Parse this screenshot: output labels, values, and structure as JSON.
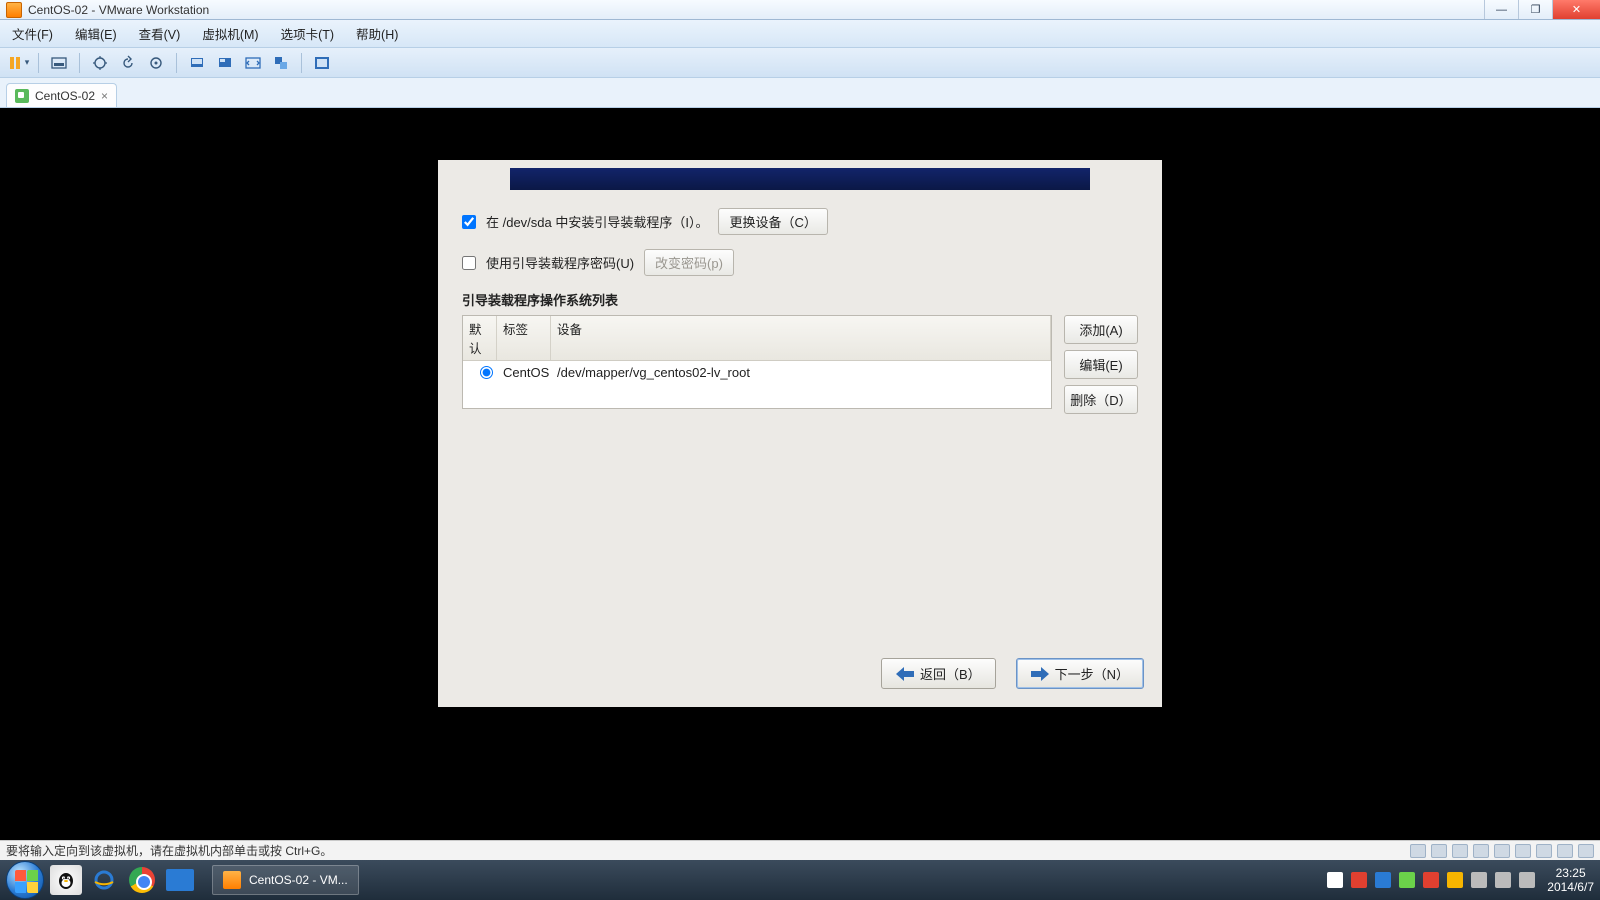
{
  "window": {
    "title": "CentOS-02 - VMware Workstation",
    "minimize": "—",
    "maximize": "❐",
    "close": "✕"
  },
  "menu": {
    "file": "文件(F)",
    "edit": "编辑(E)",
    "view": "查看(V)",
    "vm": "虚拟机(M)",
    "tabs": "选项卡(T)",
    "help": "帮助(H)"
  },
  "tab": {
    "label": "CentOS-02",
    "close": "×"
  },
  "installer": {
    "install_bootloader_label": "在 /dev/sda 中安装引导装载程序（I）。",
    "install_bootloader_checked": true,
    "change_device_btn": "更换设备（C）",
    "use_password_label": "使用引导装载程序密码(U)",
    "use_password_checked": false,
    "change_password_btn": "改变密码(p)",
    "os_list_title": "引导装载程序操作系统列表",
    "columns": {
      "default": "默认",
      "label": "标签",
      "device": "设备"
    },
    "rows": [
      {
        "default": true,
        "label": "CentOS",
        "device": "/dev/mapper/vg_centos02-lv_root"
      }
    ],
    "side_buttons": {
      "add": "添加(A)",
      "edit": "编辑(E)",
      "delete": "删除（D）"
    },
    "nav": {
      "back": "返回（B）",
      "next": "下一步（N）"
    }
  },
  "statusbar": {
    "hint": "要将输入定向到该虚拟机，请在虚拟机内部单击或按 Ctrl+G。"
  },
  "taskbar": {
    "active_task": "CentOS-02 - VM...",
    "clock_time": "23:25",
    "clock_date": "2014/6/7"
  }
}
